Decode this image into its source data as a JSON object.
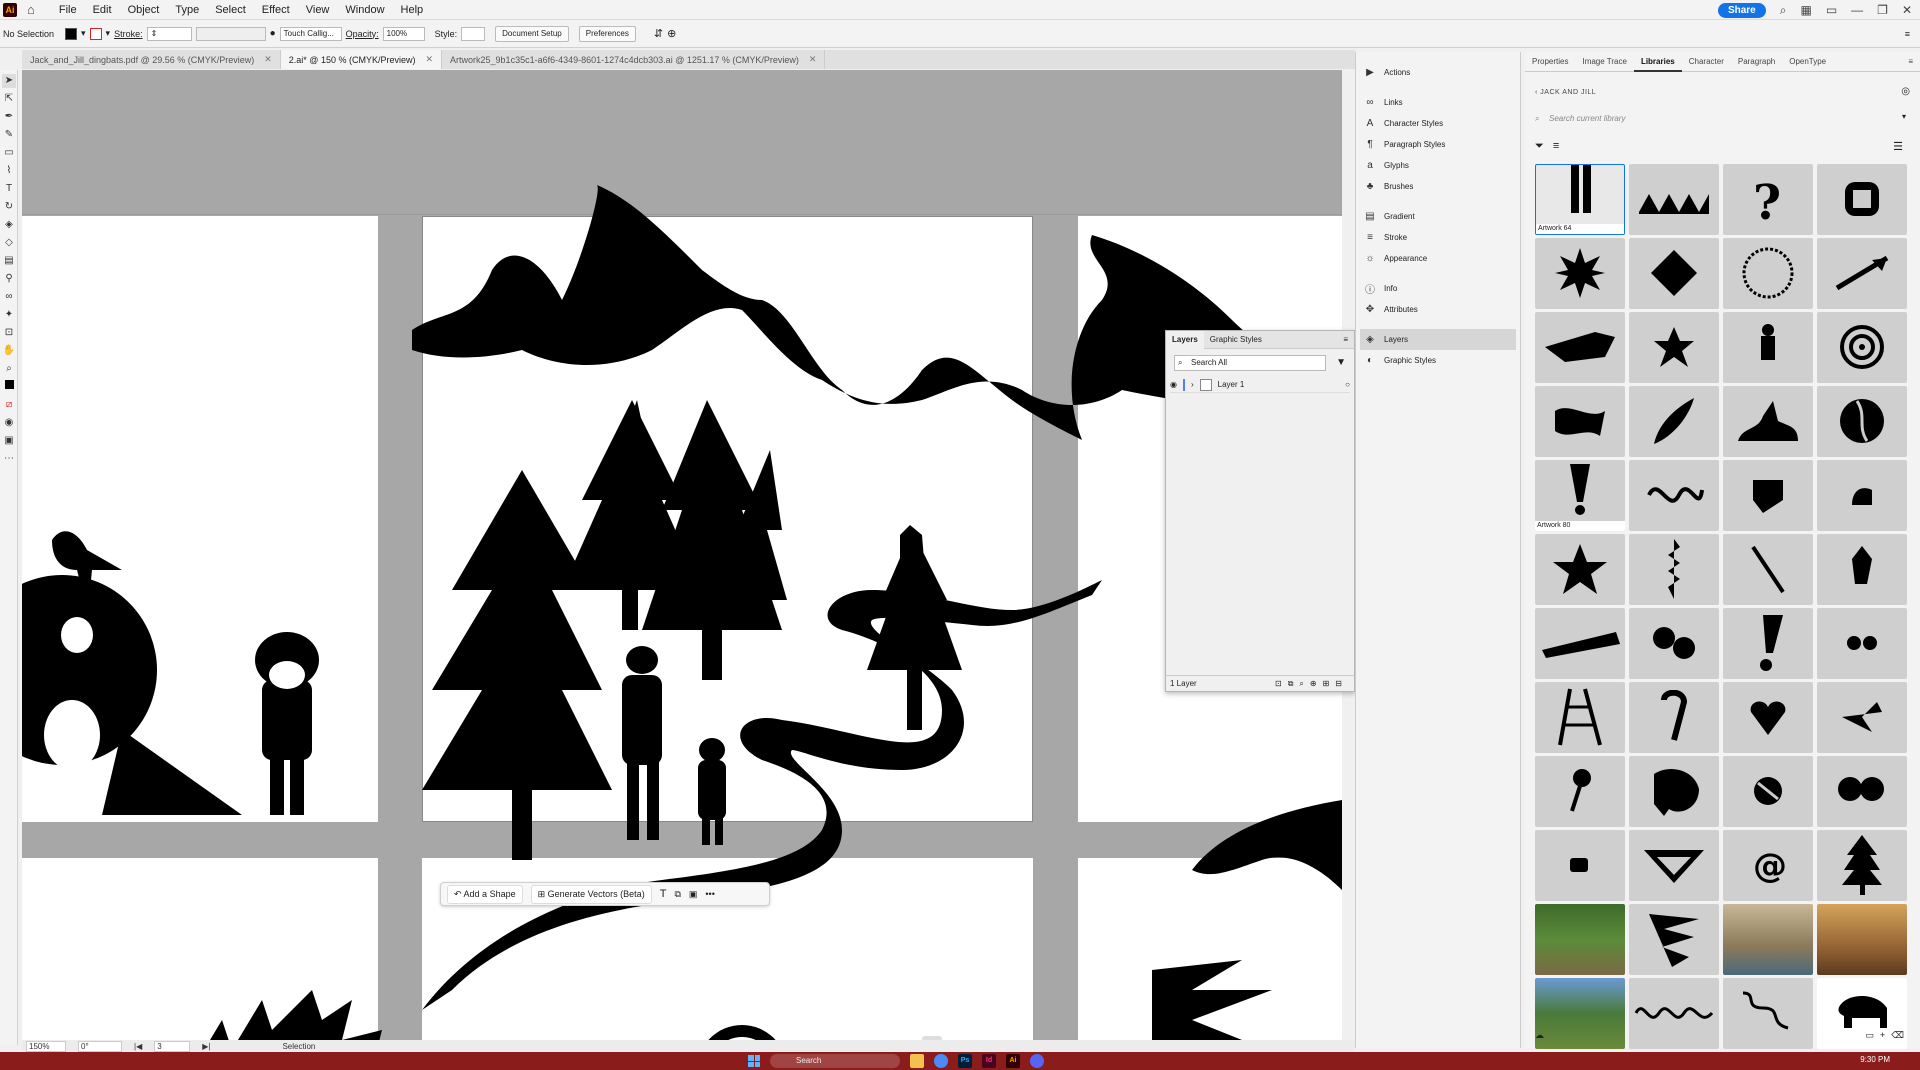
{
  "menubar": {
    "app_logo": "Ai",
    "items": [
      "File",
      "Edit",
      "Object",
      "Type",
      "Select",
      "Effect",
      "View",
      "Window",
      "Help"
    ],
    "share": "Share"
  },
  "controlbar": {
    "selection": "No Selection",
    "stroke_label": "Stroke:",
    "brush": "Touch Callig...",
    "opacity_label": "Opacity:",
    "opacity_value": "100%",
    "style_label": "Style:",
    "document_setup": "Document Setup",
    "preferences": "Preferences"
  },
  "doctabs": [
    {
      "label": "Jack_and_Jill_dingbats.pdf @ 29.56 % (CMYK/Preview)"
    },
    {
      "label": "2.ai* @ 150 % (CMYK/Preview)"
    },
    {
      "label": "Artwork25_9b1c35c1-a6f6-4349-8601-1274c4dcb303.ai @ 1251.17 % (CMYK/Preview)"
    }
  ],
  "statusbar": {
    "zoom": "150%",
    "rotation": "0°",
    "artboard": "3",
    "tool": "Selection"
  },
  "context_task_bar": {
    "add_shape": "Add a Shape",
    "generate_vectors": "Generate Vectors (Beta)"
  },
  "layers_panel": {
    "tabs": [
      "Layers",
      "Graphic Styles"
    ],
    "search_placeholder": "Search All",
    "layer_name": "Layer 1",
    "footer": "1 Layer"
  },
  "dock": {
    "items": [
      "Actions",
      "Links",
      "Character Styles",
      "Paragraph Styles",
      "Glyphs",
      "Brushes",
      "Gradient",
      "Stroke",
      "Appearance",
      "Info",
      "Attributes",
      "Layers",
      "Graphic Styles"
    ]
  },
  "right_panel": {
    "tabs": [
      "Properties",
      "Image Trace",
      "Libraries",
      "Character",
      "Paragraph",
      "OpenType"
    ],
    "library_name": "JACK AND JILL",
    "search_placeholder": "Search current library",
    "labels": {
      "artwork_64": "Artwork 64",
      "artwork_80": "Artwork 80"
    }
  },
  "windows_taskbar": {
    "search": "Search",
    "clock": "9:30 PM",
    "apps": [
      "Ps",
      "Id",
      "Ai"
    ]
  }
}
